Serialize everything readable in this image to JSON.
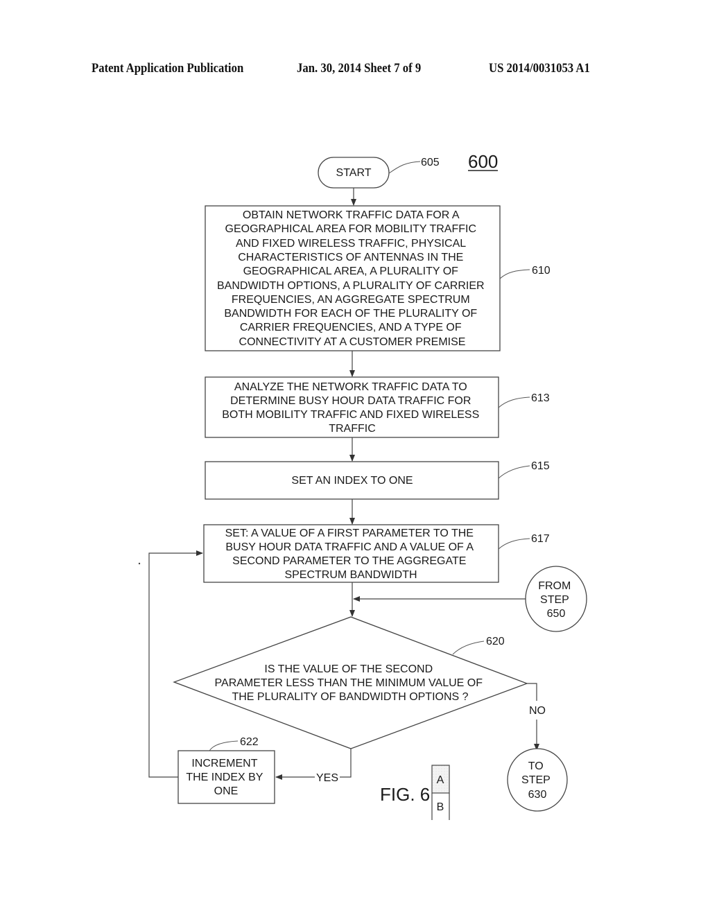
{
  "header": {
    "publication": "Patent Application Publication",
    "date_sheet": "Jan. 30, 2014  Sheet 7 of 9",
    "number": "US 2014/0031053 A1"
  },
  "figure": {
    "number": "600",
    "caption": "FIG. 6",
    "sheet_parts": [
      "A",
      "B"
    ]
  },
  "steps": {
    "start": {
      "ref": "605",
      "label": "START"
    },
    "obtain": {
      "ref": "610",
      "lines": [
        "OBTAIN NETWORK TRAFFIC DATA FOR A",
        "GEOGRAPHICAL AREA FOR MOBILITY TRAFFIC",
        "AND FIXED WIRELESS TRAFFIC, PHYSICAL",
        "CHARACTERISTICS OF ANTENNAS IN THE",
        "GEOGRAPHICAL AREA, A PLURALITY OF",
        "BANDWIDTH OPTIONS, A PLURALITY OF CARRIER",
        "FREQUENCIES, AN AGGREGATE SPECTRUM",
        "BANDWIDTH FOR EACH OF THE PLURALITY OF",
        "CARRIER FREQUENCIES, AND A TYPE OF",
        "CONNECTIVITY AT A CUSTOMER PREMISE"
      ]
    },
    "analyze": {
      "ref": "613",
      "lines": [
        "ANALYZE THE NETWORK TRAFFIC DATA TO",
        "DETERMINE BUSY HOUR DATA TRAFFIC FOR",
        "BOTH MOBILITY TRAFFIC AND FIXED WIRELESS",
        "TRAFFIC"
      ]
    },
    "set_index": {
      "ref": "615",
      "lines": [
        "SET AN INDEX TO ONE"
      ]
    },
    "set_params": {
      "ref": "617",
      "lines": [
        "SET: A VALUE OF A FIRST PARAMETER TO THE",
        "BUSY HOUR DATA TRAFFIC AND A VALUE OF A",
        "SECOND PARAMETER TO THE AGGREGATE",
        "SPECTRUM BANDWIDTH"
      ]
    },
    "decision": {
      "ref": "620",
      "lines": [
        "IS THE VALUE OF THE SECOND",
        "PARAMETER LESS THAN THE MINIMUM VALUE OF",
        "THE PLURALITY OF BANDWIDTH OPTIONS ?"
      ],
      "yes_label": "YES",
      "no_label": "NO"
    },
    "increment": {
      "ref": "622",
      "lines": [
        "INCREMENT",
        "THE INDEX BY",
        "ONE"
      ]
    },
    "from_connector": {
      "lines": [
        "FROM",
        "STEP",
        "650"
      ]
    },
    "to_connector": {
      "lines": [
        "TO",
        "STEP",
        "630"
      ]
    }
  }
}
